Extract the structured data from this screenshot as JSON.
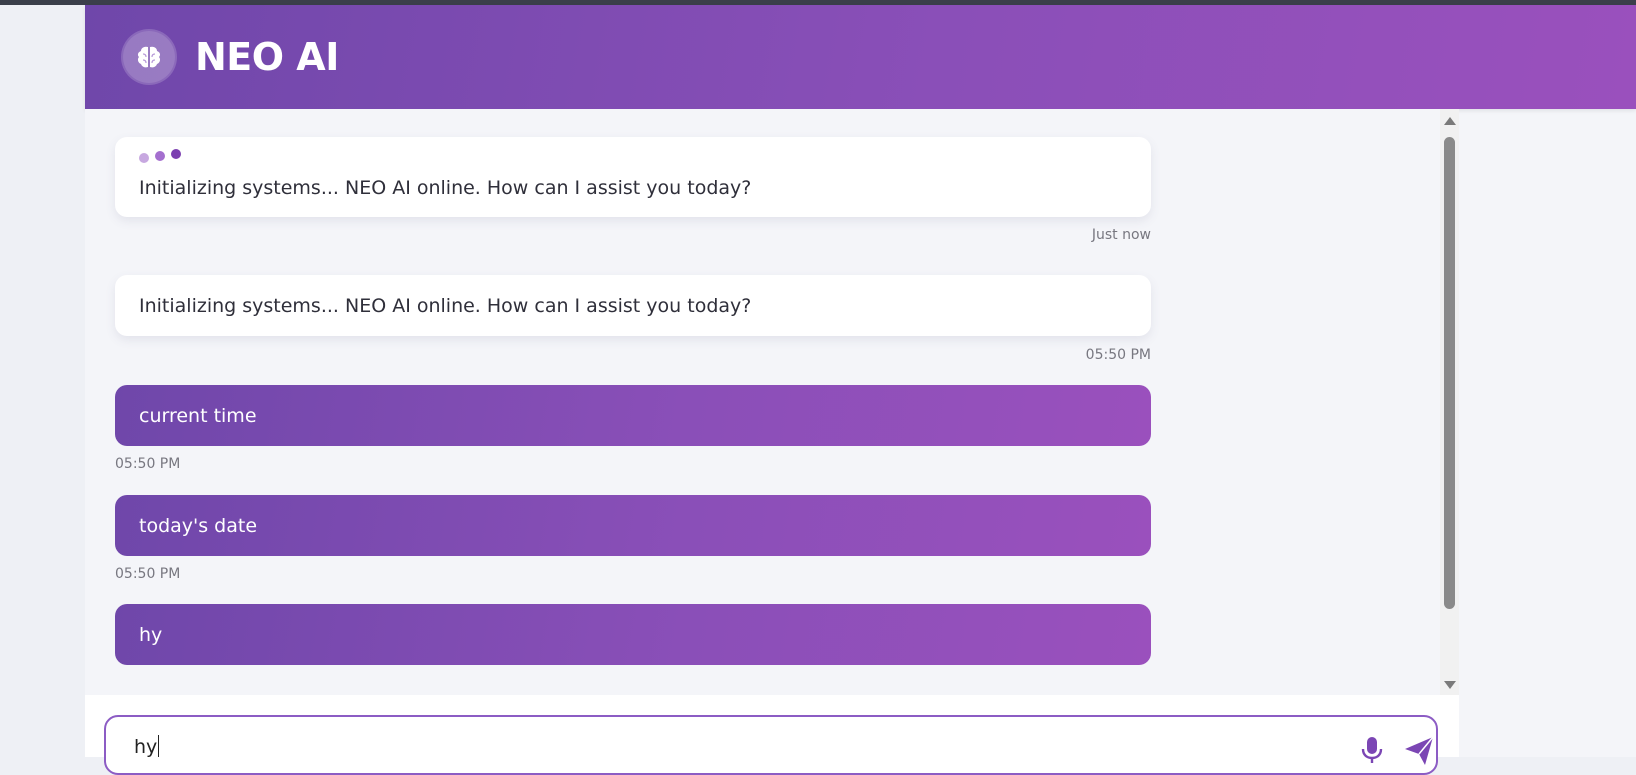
{
  "header": {
    "title": "NEO AI",
    "logo_icon": "brain-icon"
  },
  "colors": {
    "accent_start": "#6f47aa",
    "accent_end": "#9a50bd",
    "background": "#f4f5f9"
  },
  "messages": [
    {
      "role": "ai",
      "text": "Initializing systems... NEO AI online. How can I assist you today?",
      "time": "Just now",
      "typing_indicator": true
    },
    {
      "role": "ai",
      "text": "Initializing systems... NEO AI online. How can I assist you today?",
      "time": "05:50 PM"
    },
    {
      "role": "user",
      "text": "current time",
      "time": "05:50 PM"
    },
    {
      "role": "user",
      "text": "today's date",
      "time": "05:50 PM"
    },
    {
      "role": "user",
      "text": "hy",
      "time": ""
    }
  ],
  "input": {
    "value": "hy",
    "mic_icon": "microphone-icon",
    "send_icon": "send-icon"
  }
}
